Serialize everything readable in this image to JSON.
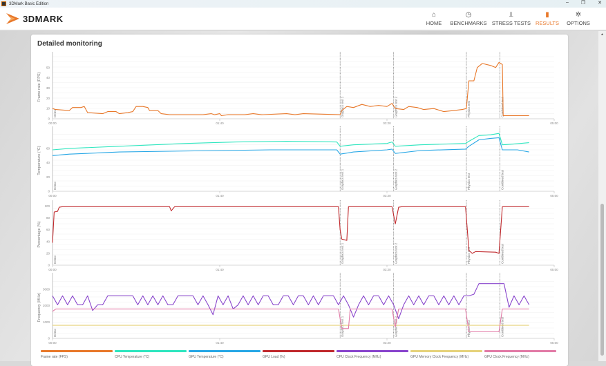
{
  "window": {
    "title": "3DMark Basic Edition",
    "controls": [
      "–",
      "❐",
      "✕"
    ]
  },
  "app": {
    "logo": "3DMARK"
  },
  "nav": [
    {
      "label": "HOME",
      "icon": "⌂",
      "active": false
    },
    {
      "label": "BENCHMARKS",
      "icon": "◷",
      "active": false
    },
    {
      "label": "STRESS TESTS",
      "icon": "⫫",
      "active": false
    },
    {
      "label": "RESULTS",
      "icon": "▮",
      "active": true
    },
    {
      "label": "OPTIONS",
      "icon": "✲",
      "active": false
    }
  ],
  "card": {
    "title": "Detailed monitoring"
  },
  "colors": {
    "accent": "#e8782a",
    "fps": "#e8782a",
    "cpu_temp": "#2ee6bf",
    "gpu_temp": "#27a7e6",
    "gpu_load": "#c0282c",
    "cpu_clock": "#8844cc",
    "gpu_mem_clock": "#e6d27a",
    "gpu_clock": "#e27aa6"
  },
  "chart_data": [
    {
      "type": "line",
      "ylabel": "Frame rate (FPS)",
      "ylim": [
        0,
        62
      ],
      "yticks": [
        0,
        10,
        20,
        30,
        40,
        50
      ],
      "xlim": [
        0,
        300
      ],
      "xticks": [
        "00:00",
        "01:40",
        "03:20",
        "05:00"
      ],
      "series": [
        {
          "name": "Frame rate (FPS)",
          "color": "#e8782a",
          "points": [
            [
              0,
              10
            ],
            [
              2,
              9
            ],
            [
              10,
              8
            ],
            [
              12,
              11
            ],
            [
              17,
              11
            ],
            [
              19,
              12
            ],
            [
              21,
              6
            ],
            [
              30,
              5
            ],
            [
              33,
              7
            ],
            [
              38,
              7
            ],
            [
              40,
              5
            ],
            [
              45,
              6
            ],
            [
              48,
              7
            ],
            [
              50,
              12
            ],
            [
              54,
              12
            ],
            [
              57,
              11
            ],
            [
              58,
              8
            ],
            [
              63,
              8
            ],
            [
              65,
              5
            ],
            [
              70,
              4
            ],
            [
              90,
              4
            ],
            [
              95,
              5
            ],
            [
              97,
              4
            ],
            [
              100,
              5
            ],
            [
              101,
              3
            ],
            [
              105,
              4
            ],
            [
              115,
              4
            ],
            [
              120,
              5
            ],
            [
              125,
              4
            ],
            [
              140,
              5
            ],
            [
              145,
              4
            ],
            [
              150,
              5
            ],
            [
              172,
              4
            ],
            [
              173,
              8
            ],
            [
              176,
              12
            ],
            [
              180,
              11
            ],
            [
              185,
              14
            ],
            [
              190,
              12
            ],
            [
              195,
              13
            ],
            [
              200,
              12
            ],
            [
              203,
              15
            ],
            [
              205,
              10
            ],
            [
              210,
              9
            ],
            [
              213,
              12
            ],
            [
              218,
              11
            ],
            [
              222,
              9
            ],
            [
              228,
              10
            ],
            [
              234,
              7
            ],
            [
              240,
              8
            ],
            [
              245,
              9
            ],
            [
              247.5,
              10
            ],
            [
              249,
              37
            ],
            [
              252,
              37
            ],
            [
              254,
              50
            ],
            [
              257,
              54
            ],
            [
              262,
              52
            ],
            [
              265,
              50
            ],
            [
              267,
              55
            ],
            [
              269,
              53
            ],
            [
              269.5,
              3
            ],
            [
              275,
              3
            ],
            [
              285,
              3
            ]
          ]
        }
      ]
    },
    {
      "type": "line",
      "ylabel": "Temperature (°C)",
      "ylim": [
        0,
        86
      ],
      "yticks": [
        0,
        20,
        40,
        60
      ],
      "xlim": [
        0,
        300
      ],
      "xticks": [
        "00:00",
        "01:40",
        "03:20",
        "05:00"
      ],
      "series": [
        {
          "name": "CPU Temperature (°C)",
          "color": "#2ee6bf",
          "points": [
            [
              0,
              58
            ],
            [
              10,
              60
            ],
            [
              40,
              63
            ],
            [
              80,
              67
            ],
            [
              110,
              69
            ],
            [
              140,
              70
            ],
            [
              170,
              69
            ],
            [
              172,
              63
            ],
            [
              180,
              65
            ],
            [
              200,
              67
            ],
            [
              203,
              69
            ],
            [
              205,
              63
            ],
            [
              220,
              65
            ],
            [
              247,
              67
            ],
            [
              249,
              70
            ],
            [
              255,
              78
            ],
            [
              262,
              79
            ],
            [
              267,
              81
            ],
            [
              269,
              65
            ],
            [
              275,
              66
            ],
            [
              285,
              68
            ]
          ]
        },
        {
          "name": "GPU Temperature (°C)",
          "color": "#27a7e6",
          "points": [
            [
              0,
              50
            ],
            [
              10,
              52
            ],
            [
              40,
              55
            ],
            [
              70,
              56
            ],
            [
              100,
              57
            ],
            [
              130,
              58
            ],
            [
              170,
              58
            ],
            [
              172,
              52
            ],
            [
              180,
              55
            ],
            [
              200,
              58
            ],
            [
              203,
              59
            ],
            [
              205,
              53
            ],
            [
              220,
              57
            ],
            [
              247,
              59
            ],
            [
              249,
              63
            ],
            [
              255,
              72
            ],
            [
              262,
              74
            ],
            [
              267,
              75
            ],
            [
              269,
              58
            ],
            [
              278,
              58
            ],
            [
              285,
              55
            ]
          ]
        }
      ]
    },
    {
      "type": "line",
      "ylabel": "Percentage (%)",
      "ylim": [
        0,
        104
      ],
      "yticks": [
        0,
        20,
        40,
        60,
        80,
        100
      ],
      "xlim": [
        0,
        300
      ],
      "xticks": [
        "00:00",
        "01:40",
        "03:20",
        "05:00"
      ],
      "series": [
        {
          "name": "GPU Load (%)",
          "color": "#c0282c",
          "points": [
            [
              0,
              38
            ],
            [
              1,
              90
            ],
            [
              3,
              91
            ],
            [
              4,
              98
            ],
            [
              6,
              99
            ],
            [
              70,
              99
            ],
            [
              71,
              92
            ],
            [
              73,
              99
            ],
            [
              171,
              99
            ],
            [
              172,
              60
            ],
            [
              173,
              44
            ],
            [
              176,
              42
            ],
            [
              177,
              99
            ],
            [
              203,
              99
            ],
            [
              205,
              70
            ],
            [
              207,
              98
            ],
            [
              209,
              99
            ],
            [
              247,
              99
            ],
            [
              249,
              25
            ],
            [
              251,
              20
            ],
            [
              253,
              23
            ],
            [
              265,
              22
            ],
            [
              267,
              20
            ],
            [
              269,
              99
            ],
            [
              285,
              99
            ]
          ]
        }
      ]
    },
    {
      "type": "line",
      "ylabel": "Frequency (MHz)",
      "ylim": [
        0,
        3800
      ],
      "yticks": [
        0,
        1000,
        2000,
        3000
      ],
      "xlim": [
        0,
        300
      ],
      "xticks": [
        "00:00",
        "01:40",
        "03:20",
        "05:00"
      ],
      "series": [
        {
          "name": "CPU Clock Frequency (MHz)",
          "color": "#8844cc",
          "step": 3,
          "values": [
            2600,
            2050,
            2600,
            2050,
            2600,
            2050,
            2050,
            2600,
            1700,
            2050,
            2050,
            2600,
            2600,
            2600,
            2600,
            2600,
            2600,
            2050,
            2600,
            2050,
            2600,
            2050,
            2600,
            2050,
            2050,
            2600,
            2600,
            2600,
            2600,
            2050,
            2600,
            2050,
            1450,
            2600,
            2050,
            2600,
            1800,
            2050,
            2600,
            2050,
            2600,
            2050,
            2600,
            2600,
            2050,
            2050,
            2600,
            2600,
            2050,
            2600,
            2600,
            2050,
            2600,
            2050,
            2600,
            2600,
            2600,
            2050,
            2600,
            2050,
            1300,
            2050,
            2600,
            2050,
            2600,
            2600,
            2050,
            2600,
            2050,
            1200,
            2050,
            2600,
            2050,
            2600,
            2050,
            2600,
            2600,
            2050,
            2600,
            2050,
            2600,
            2050,
            2600,
            2600,
            2700,
            3350,
            3350,
            3350,
            3350,
            3350,
            3350,
            1900,
            2600,
            2050,
            2600,
            2050
          ]
        },
        {
          "name": "GPU Memory Clock Frequency (MHz)",
          "color": "#e6d27a",
          "points": [
            [
              0,
              800
            ],
            [
              285,
              800
            ]
          ]
        },
        {
          "name": "GPU Clock Frequency (MHz)",
          "color": "#e27aa6",
          "points": [
            [
              0,
              1650
            ],
            [
              2,
              1800
            ],
            [
              171,
              1800
            ],
            [
              173,
              600
            ],
            [
              177,
              600
            ],
            [
              178,
              1800
            ],
            [
              203,
              1800
            ],
            [
              205,
              700
            ],
            [
              207,
              1800
            ],
            [
              247,
              1800
            ],
            [
              249,
              400
            ],
            [
              267,
              400
            ],
            [
              269,
              1800
            ],
            [
              285,
              1800
            ]
          ]
        }
      ]
    }
  ],
  "markers": [
    {
      "t": 0,
      "label": "Demo"
    },
    {
      "t": 172,
      "label": "Graphics test 1"
    },
    {
      "t": 204,
      "label": "Graphics test 2"
    },
    {
      "t": 247.5,
      "label": "Physics test"
    },
    {
      "t": 267.5,
      "label": "Combined test"
    }
  ],
  "legend": [
    {
      "label": "Frame rate (FPS)",
      "color": "#e8782a"
    },
    {
      "label": "CPU Temperature (°C)",
      "color": "#2ee6bf"
    },
    {
      "label": "GPU Temperature (°C)",
      "color": "#27a7e6"
    },
    {
      "label": "GPU Load (%)",
      "color": "#c0282c"
    },
    {
      "label": "CPU Clock Frequency (MHz)",
      "color": "#8844cc"
    },
    {
      "label": "GPU Memory Clock Frequency (MHz)",
      "color": "#e6d27a"
    },
    {
      "label": "GPU Clock Frequency (MHz)",
      "color": "#e27aa6"
    }
  ]
}
